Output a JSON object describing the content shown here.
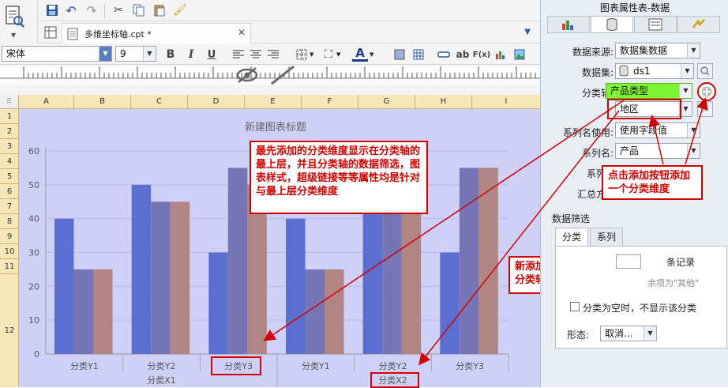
{
  "document": {
    "tab_label": "多维坐标轴.cpt *"
  },
  "format_bar": {
    "font_name": "宋体",
    "font_size": "9",
    "bold": "B",
    "italic": "I",
    "underline": "U",
    "ab_label": "ab",
    "fx_label": "F(x)"
  },
  "sheet": {
    "columns": [
      "A",
      "B",
      "C",
      "D",
      "E",
      "F",
      "G",
      "H",
      "I"
    ],
    "rows": [
      "1",
      "2",
      "3",
      "4",
      "5",
      "6",
      "7",
      "8",
      "9",
      "10",
      "11",
      "12"
    ]
  },
  "chart_data": {
    "type": "bar",
    "title": "新建图表标题",
    "categories": [
      "分类Y1",
      "分类Y2",
      "分类Y3",
      "分类Y1",
      "分类Y2",
      "分类Y3"
    ],
    "groups": [
      "分类X1",
      "分类X2"
    ],
    "series": [
      {
        "values": [
          40,
          50,
          30,
          40,
          50,
          30
        ]
      },
      {
        "values": [
          25,
          45,
          55,
          25,
          45,
          55
        ]
      },
      {
        "values": [
          25,
          45,
          50,
          25,
          45,
          55
        ]
      }
    ],
    "ylim": [
      0,
      60
    ],
    "yticks": [
      "60",
      "50",
      "40",
      "30",
      "20",
      "10",
      "0"
    ],
    "colors": [
      "#5b6fd0",
      "#7676b6",
      "#b08584"
    ]
  },
  "panel": {
    "title": "图表属性表-数据",
    "data_source_label": "数据来源:",
    "data_source_value": "数据集数据",
    "dataset_label": "数据集:",
    "dataset_value": "ds1",
    "category_axis_label": "分类轴:",
    "category_axis_value": "产品类型",
    "category_axis_value2": "地区",
    "series_name_use_label": "系列名使用:",
    "series_name_use_value": "使用字段值",
    "series_name_label": "系列名:",
    "series_name_value": "产品",
    "series_value_label": "系列",
    "summary_label": "汇总方",
    "filter_title": "数据筛选",
    "filter_tab_category": "分类",
    "filter_tab_series": "系列",
    "records_suffix": "条记录",
    "remaining_text": "余项为\"其他\"",
    "empty_category_label": "分类为空时，不显示该分类",
    "form_label": "形态:",
    "form_value": "取消..."
  },
  "annotations": {
    "callout1": "最先添加的分类维度显示在分类轴的最上层，并且分类轴的数据筛选，图表样式，超级链接等等属性均是针对与最上层分类维度",
    "callout2": "点击添加按钮添加一个分类维度",
    "callout3": "新添加的分类维度显示在分类轴最下层"
  }
}
